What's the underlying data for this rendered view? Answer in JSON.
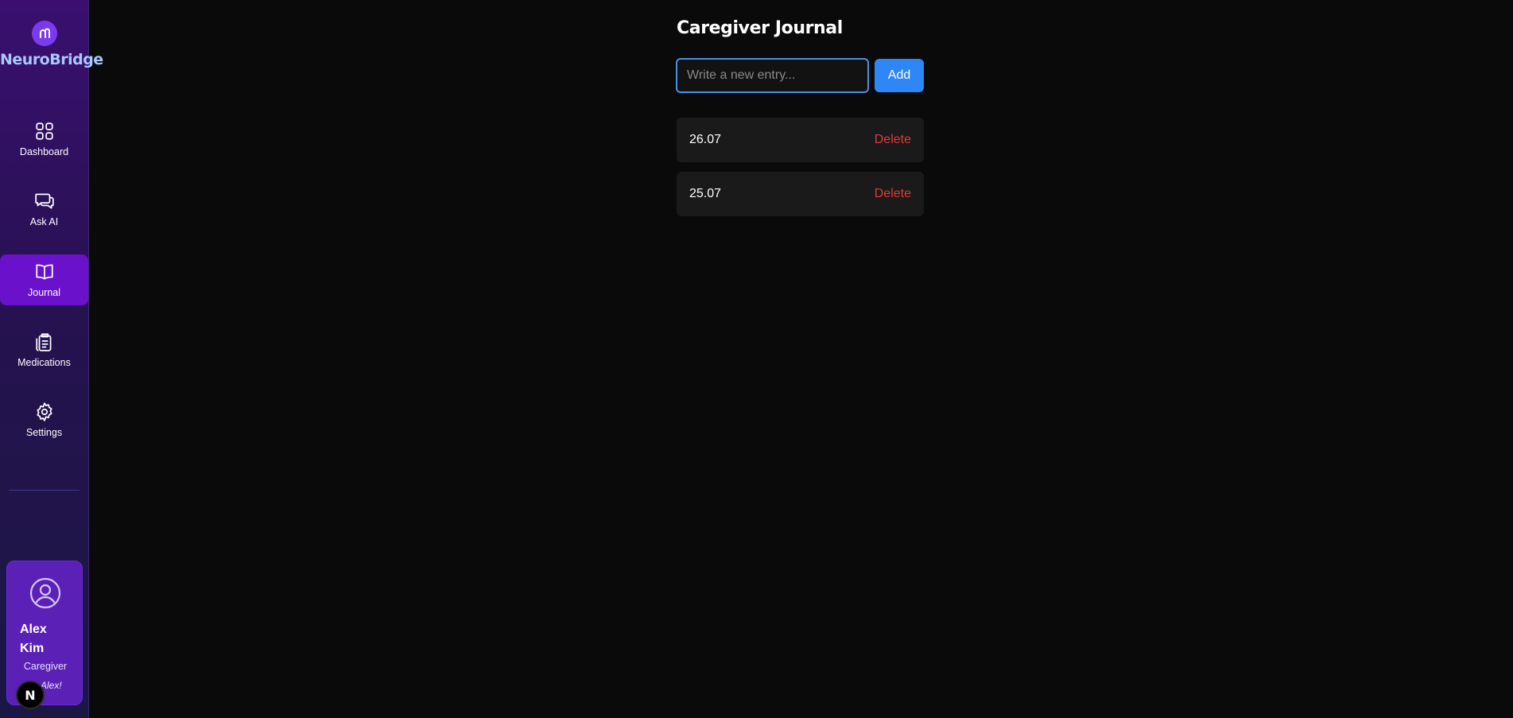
{
  "app": {
    "logo_letter": "m",
    "name": "NeuroBridge"
  },
  "sidebar": {
    "items": [
      {
        "label": "Dashboard",
        "icon": "grid-icon",
        "active": false
      },
      {
        "label": "Ask AI",
        "icon": "chat-icon",
        "active": false
      },
      {
        "label": "Journal",
        "icon": "book-icon",
        "active": true
      },
      {
        "label": "Medications",
        "icon": "clipboard-icon",
        "active": false
      },
      {
        "label": "Settings",
        "icon": "gear-icon",
        "active": false
      }
    ]
  },
  "user": {
    "name": "Alex Kim",
    "role": "Caregiver",
    "greeting": "Alex!"
  },
  "badge": {
    "letter": "N"
  },
  "main": {
    "title": "Caregiver Journal",
    "input_placeholder": "Write a new entry...",
    "input_value": "",
    "add_label": "Add",
    "entries": [
      {
        "date": "26.07",
        "delete_label": "Delete"
      },
      {
        "date": "25.07",
        "delete_label": "Delete"
      }
    ]
  },
  "colors": {
    "accent": "#6a11cb",
    "primary_button": "#2f86f6",
    "danger": "#e53935",
    "background": "#0a0a0a"
  }
}
